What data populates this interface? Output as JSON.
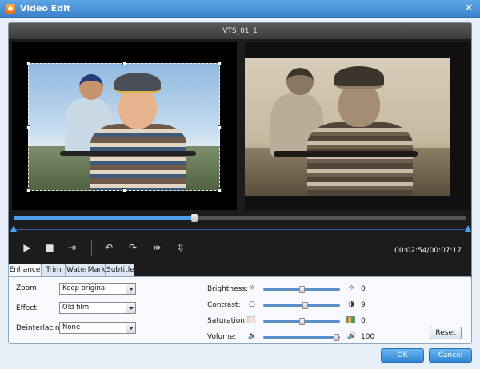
{
  "window": {
    "title": "Video Edit",
    "close_glyph": "✕"
  },
  "player": {
    "file_name": "VTS_01_1",
    "time_display": "00:02:54/00:07:17",
    "progress_fraction": 0.4,
    "controls": {
      "play_glyph": "▶",
      "stop_glyph": "■",
      "snapshot_glyph": "⇥",
      "rotate_left_glyph": "↶",
      "rotate_right_glyph": "↷",
      "flip_horizontal_glyph": "⇹",
      "flip_vertical_glyph": "⇳"
    }
  },
  "tabs": [
    {
      "label": "Enhance",
      "active": true
    },
    {
      "label": "Trim",
      "active": false
    },
    {
      "label": "WaterMark",
      "active": false
    },
    {
      "label": "Subtitle",
      "active": false
    }
  ],
  "enhance": {
    "zoom": {
      "label": "Zoom:",
      "value": "Keep original"
    },
    "effect": {
      "label": "Effect:",
      "value": "Old film"
    },
    "deinterlacing": {
      "label": "Deinterlacing:",
      "value": "None"
    },
    "brightness": {
      "label": "Brightness:",
      "value": "0",
      "fraction": 0.5,
      "icon_left": "☼",
      "icon_right": "☼"
    },
    "contrast": {
      "label": "Contrast:",
      "value": "9",
      "fraction": 0.54,
      "icon_left": "○",
      "icon_right": "◑"
    },
    "saturation": {
      "label": "Saturation:",
      "value": "0",
      "fraction": 0.5
    },
    "volume": {
      "label": "Volume:",
      "value": "100",
      "fraction": 0.95,
      "icon_left": "🔈",
      "icon_right": "🔊"
    },
    "reset_label": "Reset"
  },
  "footer": {
    "ok_label": "OK",
    "cancel_label": "Cancel"
  },
  "colors": {
    "accent": "#2f86d3",
    "titlebar": "#3b82cc",
    "progress": "#4ea0e8"
  }
}
